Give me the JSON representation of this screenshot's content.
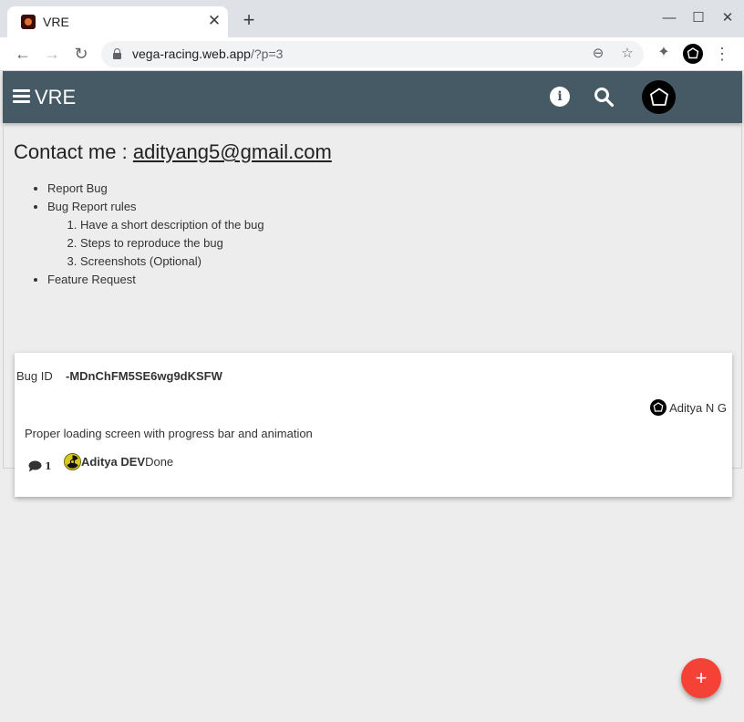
{
  "browser": {
    "tab_title": "VRE",
    "url_host": "vega-racing.web.app",
    "url_path": "/?p=3",
    "icons": {
      "new_tab": "+",
      "close": "✕",
      "minimize": "—",
      "maximize": "☐",
      "back": "←",
      "forward": "→",
      "reload": "↻",
      "zoom": "⊖",
      "star": "☆",
      "extensions": "✦",
      "menu": "⋮"
    }
  },
  "appbar": {
    "title": "VRE",
    "info_glyph": "i",
    "background": "#455a64"
  },
  "contact": {
    "label": "Contact me : ",
    "email": "adityang5@gmail.com"
  },
  "menu": {
    "items": [
      "Report Bug",
      "Bug Report rules",
      "Feature Request"
    ],
    "rules": [
      "Have a short description of the bug",
      "Steps to reproduce the bug",
      "Screenshots (Optional)"
    ]
  },
  "bug": {
    "id_label": "Bug ID",
    "id_value": "-MDnChFM5SE6wg9dKSFW",
    "reporter": "Aditya N G",
    "description": "Proper loading screen with progress bar and animation",
    "comment_count": "1",
    "assignee": "Aditya DEV",
    "status": "Done"
  },
  "fab": {
    "label": "+",
    "color": "#f44336"
  }
}
